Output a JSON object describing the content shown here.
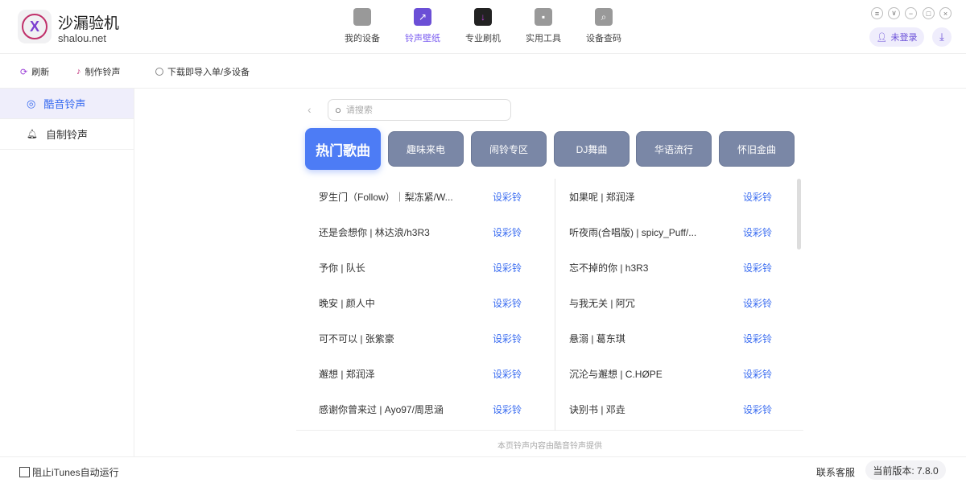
{
  "app": {
    "title": "沙漏验机",
    "subtitle": "shalou.net",
    "logo_text": "X"
  },
  "nav": [
    {
      "label": "我的设备",
      "icon": "apple-icon"
    },
    {
      "label": "铃声壁纸",
      "icon": "wallpaper-icon"
    },
    {
      "label": "专业刷机",
      "icon": "flash-icon"
    },
    {
      "label": "实用工具",
      "icon": "toolbox-icon"
    },
    {
      "label": "设备查码",
      "icon": "search-doc-icon"
    }
  ],
  "header": {
    "login": "未登录"
  },
  "toolbar": {
    "refresh": "刷新",
    "make": "制作铃声",
    "import": "下载即导入单/多设备"
  },
  "sidebar": [
    {
      "label": "酷音铃声"
    },
    {
      "label": "自制铃声"
    }
  ],
  "search": {
    "placeholder": "请搜索"
  },
  "categories": [
    "热门歌曲",
    "趣味来电",
    "闹铃专区",
    "DJ舞曲",
    "华语流行",
    "怀旧金曲"
  ],
  "set_label": "设彩铃",
  "songs_left": [
    "罗生门（Follow）｜梨冻紧/W...",
    "还是会想你 | 林达浪/h3R3",
    "予你 | 队长",
    "晚安 | 颜人中",
    "可不可以 | 张紫豪",
    "邂想 | 郑润泽",
    "感谢你曾来过 | Ayo97/周思涵"
  ],
  "songs_right": [
    "如果呢 | 郑润泽",
    "听夜雨(合唱版) | spicy_Puff/...",
    "忘不掉的你 | h3R3",
    "与我无关 | 阿冗",
    "悬溺 | 葛东琪",
    "沉沦与邂想 | C.HØPE",
    "诀别书 | 邓垚"
  ],
  "credit": "本页铃声内容由酷音铃声提供",
  "footer": {
    "itunes": "阻止iTunes自动运行",
    "contact": "联系客服",
    "version": "当前版本: 7.8.0"
  }
}
